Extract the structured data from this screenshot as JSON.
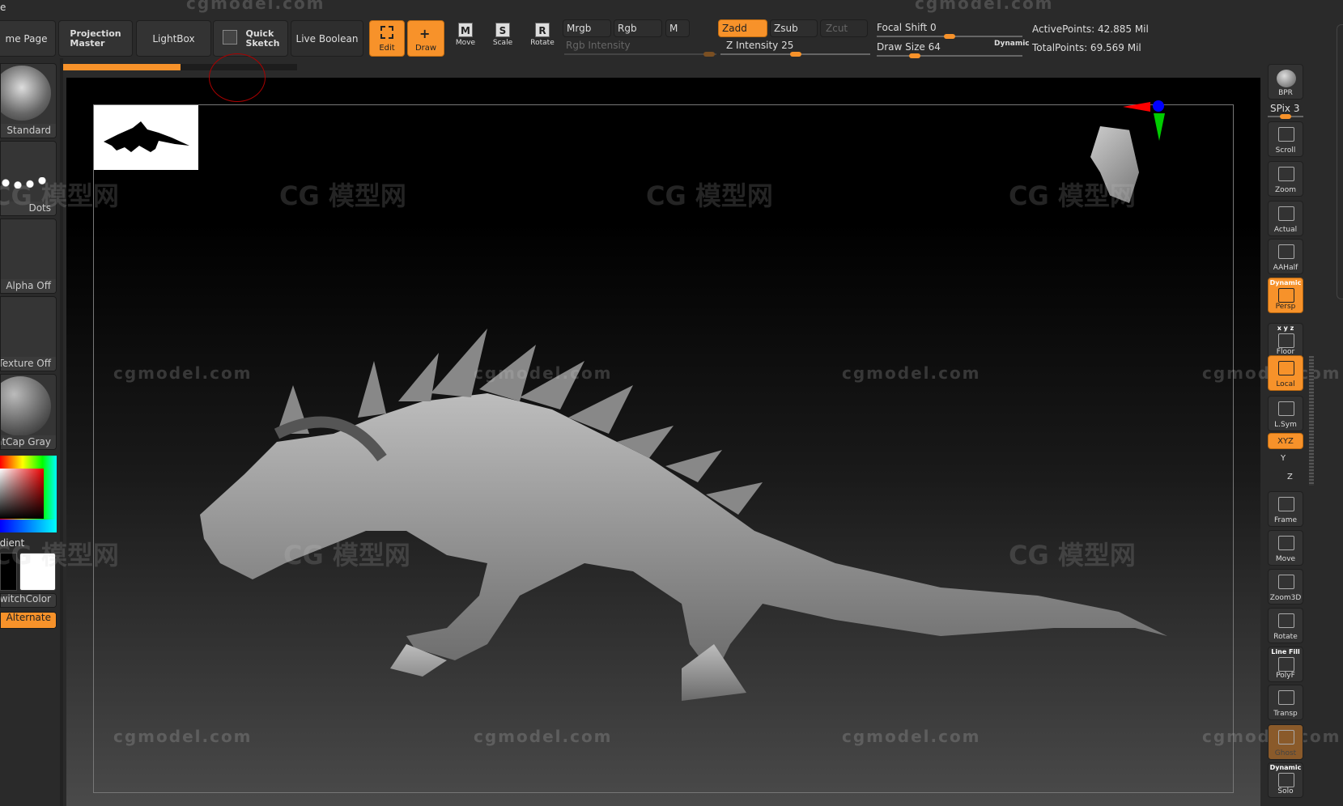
{
  "menu": {
    "partial_item": "e"
  },
  "top": {
    "home_page": "me Page",
    "projection_master": "Projection\nMaster",
    "lightbox": "LightBox",
    "quick_sketch": "Quick\nSketch",
    "live_boolean": "Live Boolean",
    "edit": "Edit",
    "draw": "Draw",
    "move": "Move",
    "scale": "Scale",
    "rotate": "Rotate",
    "mrgb": "Mrgb",
    "rgb": "Rgb",
    "m": "M",
    "rgb_intensity": "Rgb Intensity",
    "zadd": "Zadd",
    "zsub": "Zsub",
    "zcut": "Zcut",
    "z_intensity": "Z Intensity 25",
    "focal_shift": "Focal Shift 0",
    "draw_size": "Draw Size 64",
    "dynamic": "Dynamic",
    "active_points": "ActivePoints: 42.885 Mil",
    "total_points": "TotalPoints: 69.569 Mil",
    "progress_percent": 50
  },
  "left": {
    "brush": "Standard",
    "stroke": "Dots",
    "alpha": "Alpha Off",
    "texture": "Texture Off",
    "material": "MatCap Gray",
    "gradient": "Gradient",
    "switch_color": "SwitchColor",
    "alternate": "Alternate"
  },
  "right": [
    {
      "label": "BPR",
      "icon": "bpr-sphere",
      "state": "off"
    },
    {
      "label": "Scroll",
      "icon": "hand-icon",
      "state": "off"
    },
    {
      "label": "Zoom",
      "icon": "magnifier-icon",
      "state": "off"
    },
    {
      "label": "Actual",
      "icon": "magnifier-x1-icon",
      "state": "off"
    },
    {
      "label": "AAHalf",
      "icon": "magnifier-half-icon",
      "state": "off"
    },
    {
      "label": "Persp",
      "icon": "grid-perspective-icon",
      "state": "on",
      "top": "Dynamic"
    },
    {
      "label": "Floor",
      "icon": "floor-icon",
      "state": "off",
      "top": "x y z"
    },
    {
      "label": "Local",
      "icon": "local-icon",
      "state": "on"
    },
    {
      "label": "L.Sym",
      "icon": "symmetry-icon",
      "state": "off"
    },
    {
      "label": "Frame",
      "icon": "frame-icon",
      "state": "off"
    },
    {
      "label": "Move",
      "icon": "hand-sphere-icon",
      "state": "off"
    },
    {
      "label": "Zoom3D",
      "icon": "zoom3d-icon",
      "state": "off"
    },
    {
      "label": "Rotate",
      "icon": "rotate-icon",
      "state": "off"
    },
    {
      "label": "PolyF",
      "icon": "polyframe-icon",
      "state": "off",
      "top": "Line Fill"
    },
    {
      "label": "Transp",
      "icon": "transparent-icon",
      "state": "off"
    },
    {
      "label": "Ghost",
      "icon": "ghost-icon",
      "state": "dim"
    },
    {
      "label": "Solo",
      "icon": "solo-icon",
      "state": "off",
      "top": "Dynamic"
    }
  ],
  "spix": "SPix 3",
  "xyz": "XYZ",
  "rot_y": "Y",
  "rot_z": "Z",
  "watermarks": {
    "latin": "cgmodel.com",
    "cjk": "CG 模型网"
  },
  "colors": {
    "accent": "#f7922a",
    "panel": "#2a2a2a",
    "canvas_top": "#000000",
    "canvas_bottom": "#4a4a4a"
  }
}
